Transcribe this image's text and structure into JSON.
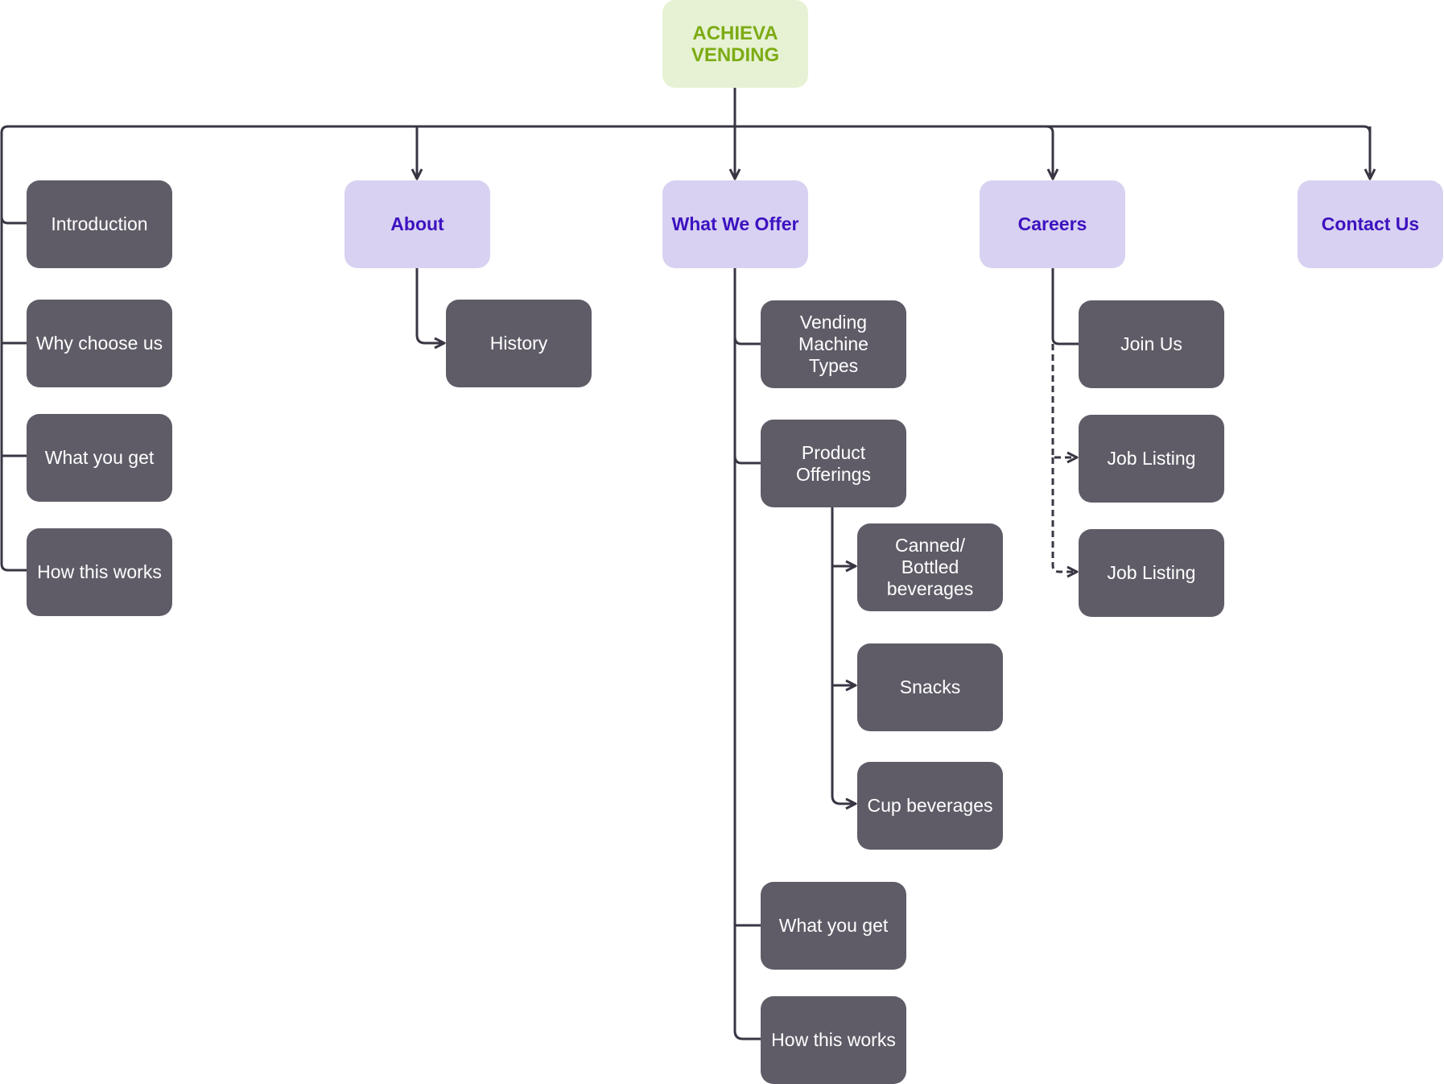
{
  "colors": {
    "root_bg": "#e6f2d3",
    "root_text": "#7dab14",
    "category_bg": "#d8d1f1",
    "category_text": "#3d12c0",
    "page_bg": "#5f5c67",
    "connector": "#3a3543"
  },
  "root": {
    "label": "ACHIEVA\nVENDING"
  },
  "categories": {
    "introduction": "Introduction",
    "about": "About",
    "what_we_offer": "What We Offer",
    "careers": "Careers",
    "contact_us": "Contact Us"
  },
  "intro_children": [
    "Why choose us",
    "What you get",
    "How this works"
  ],
  "about_children": [
    "History"
  ],
  "offer_children": [
    "Vending Machine Types",
    "Product Offerings",
    "What you get",
    "How this works"
  ],
  "product_children": [
    "Canned/ Bottled beverages",
    "Snacks",
    "Cup beverages"
  ],
  "careers_children": [
    "Join Us",
    "Job Listing",
    "Job Listing"
  ]
}
